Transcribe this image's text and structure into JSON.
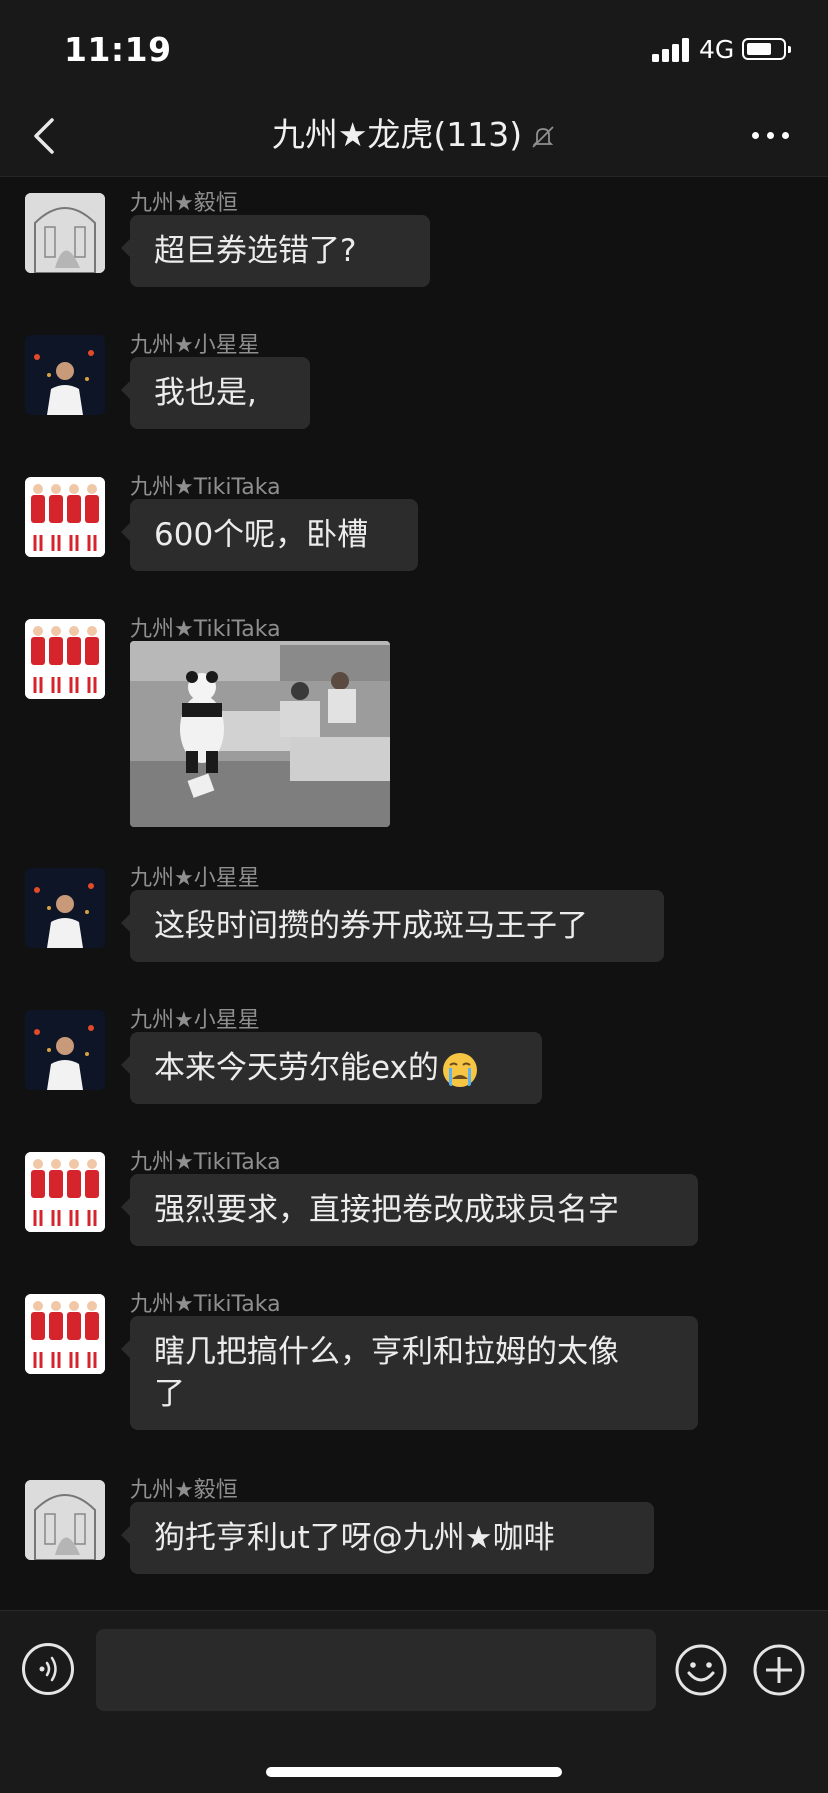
{
  "status": {
    "time": "11:19",
    "network": "4G"
  },
  "nav": {
    "title": "九州★龙虎(113)"
  },
  "messages": [
    {
      "sender": "九州★毅恒",
      "text": "超巨券选错了?"
    },
    {
      "sender": "九州★小星星",
      "text": "我也是,"
    },
    {
      "sender": "九州★TikiTaka",
      "text": "600个呢，卧槽"
    },
    {
      "sender": "九州★TikiTaka",
      "image": "panda-office-photo"
    },
    {
      "sender": "九州★小星星",
      "text": "这段时间攒的券开成斑马王子了"
    },
    {
      "sender": "九州★小星星",
      "text": "本来今天劳尔能ex的",
      "emoji": "crying-face"
    },
    {
      "sender": "九州★TikiTaka",
      "text": "强烈要求，直接把卷改成球员名字"
    },
    {
      "sender": "九州★TikiTaka",
      "text_line1": "瞎几把搞什么，亨利和拉姆的太像",
      "text_line2": "了"
    },
    {
      "sender": "九州★毅恒",
      "text": "狗托亨利ut了呀@九州★咖啡"
    }
  ],
  "input": {
    "placeholder": ""
  },
  "colors": {
    "background": "#111111",
    "bubble": "#2c2c2c",
    "bar": "#191919",
    "sender": "#8f8f8f"
  }
}
